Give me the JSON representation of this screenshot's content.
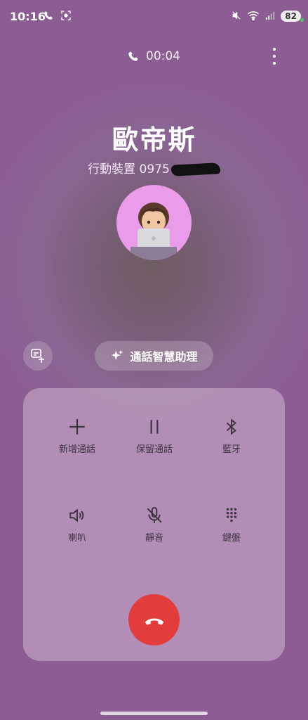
{
  "status_bar": {
    "time": "10:16",
    "battery": "82"
  },
  "call": {
    "timer": "00:04",
    "caller_name": "歐帝斯",
    "caller_sub": "行動裝置 0975"
  },
  "assistant": {
    "label": "通話智慧助理"
  },
  "controls": {
    "add_call": "新增通話",
    "hold": "保留通話",
    "bluetooth": "藍牙",
    "speaker": "喇叭",
    "mute": "靜音",
    "keypad": "鍵盤"
  },
  "colors": {
    "end_call": "#e33c3c",
    "avatar_bg": "#ea9bea"
  }
}
